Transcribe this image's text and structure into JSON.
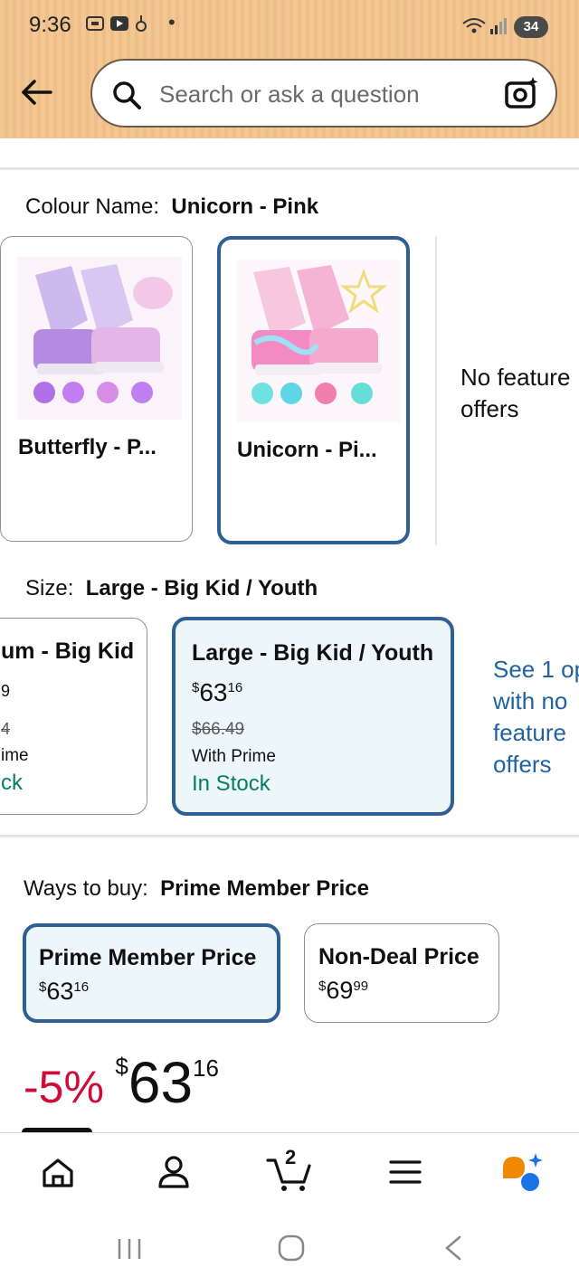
{
  "status_bar": {
    "time": "9:36",
    "battery": "34"
  },
  "search": {
    "placeholder": "Search or ask a question"
  },
  "colour": {
    "label": "Colour Name:",
    "selected": "Unicorn - Pink",
    "options": [
      {
        "title": "Butterfly - P..."
      },
      {
        "title": "Unicorn - Pi..."
      }
    ],
    "no_featured_line1": "No feature",
    "no_featured_line2": "offers"
  },
  "size": {
    "label": "Size:",
    "selected": "Large - Big Kid / Youth",
    "left_card": {
      "title": "um - Big Kid",
      "line2": "9",
      "line3": "4",
      "line4": "ime",
      "line5": "ck"
    },
    "selected_card": {
      "title": "Large - Big Kid / Youth",
      "price_symbol": "$",
      "price_whole": "63",
      "price_fraction": "16",
      "list_price": "$66.49",
      "prime": "With Prime",
      "stock": "In Stock"
    },
    "see_options": [
      "See 1 op",
      "with no",
      "feature",
      "offers"
    ]
  },
  "ways_to_buy": {
    "label": "Ways to buy:",
    "selected": "Prime Member Price",
    "options": [
      {
        "title": "Prime Member Price",
        "symbol": "$",
        "whole": "63",
        "fraction": "16"
      },
      {
        "title": "Non-Deal Price",
        "symbol": "$",
        "whole": "69",
        "fraction": "99"
      }
    ]
  },
  "deal": {
    "discount": "-5%",
    "symbol": "$",
    "whole": "63",
    "fraction": "16"
  },
  "bottom_nav": {
    "cart_count": "2"
  },
  "colors": {
    "accent_border": "#2e5f95",
    "selected_bg": "#edf7fa",
    "in_stock": "#067d62",
    "discount": "#cc0c39",
    "link": "#2162a1",
    "header": "#f3c793"
  }
}
